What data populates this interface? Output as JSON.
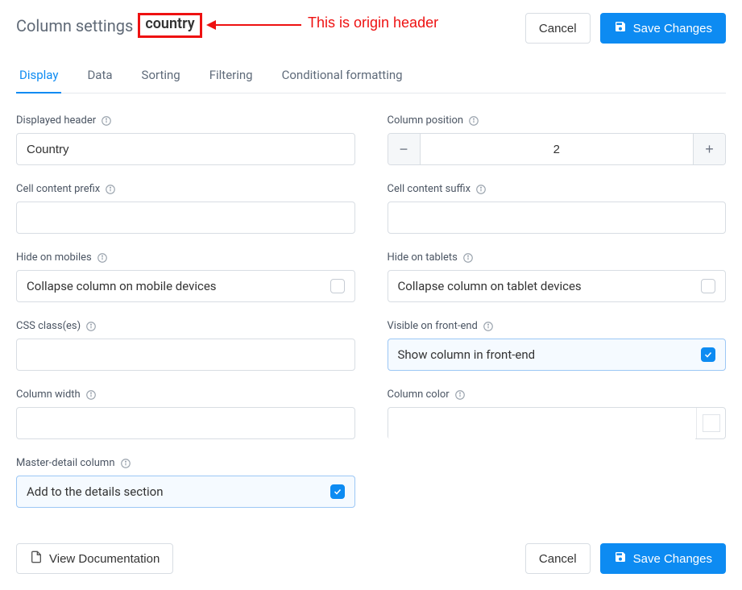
{
  "header": {
    "title": "Column settings",
    "origin_header": "country",
    "annotation": "This is origin header",
    "cancel": "Cancel",
    "save": "Save Changes"
  },
  "tabs": [
    {
      "id": "display",
      "label": "Display",
      "active": true
    },
    {
      "id": "data",
      "label": "Data",
      "active": false
    },
    {
      "id": "sorting",
      "label": "Sorting",
      "active": false
    },
    {
      "id": "filtering",
      "label": "Filtering",
      "active": false
    },
    {
      "id": "conditional",
      "label": "Conditional formatting",
      "active": false
    }
  ],
  "fields": {
    "displayed_header": {
      "label": "Displayed header",
      "value": "Country"
    },
    "column_position": {
      "label": "Column position",
      "value": "2"
    },
    "cell_prefix": {
      "label": "Cell content prefix",
      "value": ""
    },
    "cell_suffix": {
      "label": "Cell content suffix",
      "value": ""
    },
    "hide_mobiles": {
      "label": "Hide on mobiles",
      "option": "Collapse column on mobile devices",
      "checked": false
    },
    "hide_tablets": {
      "label": "Hide on tablets",
      "option": "Collapse column on tablet devices",
      "checked": false
    },
    "css_classes": {
      "label": "CSS class(es)",
      "value": ""
    },
    "visible_front": {
      "label": "Visible on front-end",
      "option": "Show column in front-end",
      "checked": true
    },
    "column_width": {
      "label": "Column width",
      "value": ""
    },
    "column_color": {
      "label": "Column color",
      "value": ""
    },
    "master_detail": {
      "label": "Master-detail column",
      "option": "Add to the details section",
      "checked": true
    }
  },
  "footer": {
    "docs": "View Documentation",
    "cancel": "Cancel",
    "save": "Save Changes"
  }
}
